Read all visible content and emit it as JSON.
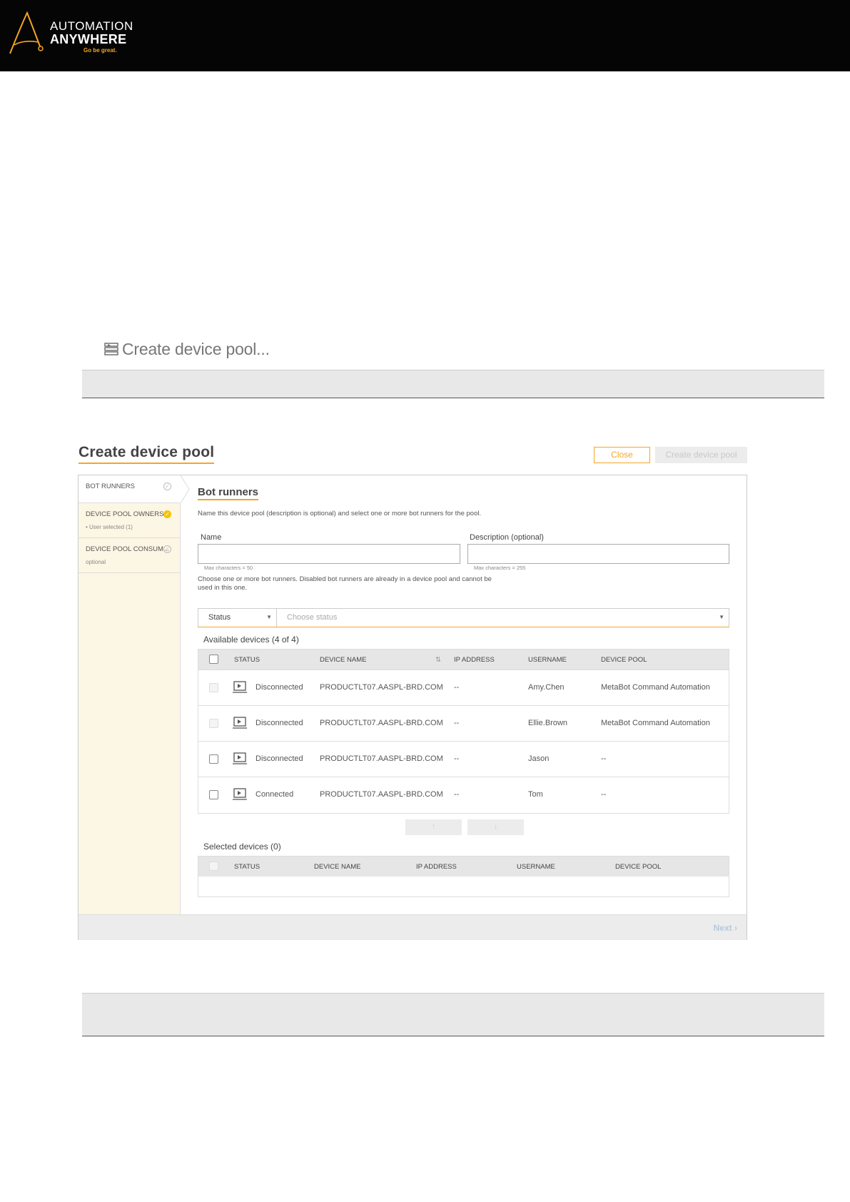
{
  "brand": {
    "line1": "AUTOMATION",
    "line2": "ANYWHERE",
    "tagline": "Go be great.",
    "accent": "#f5a623"
  },
  "section": {
    "icon": "device-pool-icon",
    "title": "Create device pool..."
  },
  "dialog": {
    "title": "Create device pool",
    "close_label": "Close",
    "create_label": "Create device pool",
    "next_label": "Next",
    "steps": [
      {
        "label": "BOT RUNNERS",
        "sub": ""
      },
      {
        "label": "DEVICE POOL OWNERS",
        "sub": "• User selected (1)"
      },
      {
        "label": "DEVICE POOL CONSUM...",
        "sub": "optional"
      }
    ],
    "panel": {
      "title": "Bot runners",
      "description": "Name this device pool (description is optional) and select one or more bot runners for the pool.",
      "name_label": "Name",
      "name_value": "",
      "name_hint": "Max characters = 50",
      "desc_label": "Description (optional)",
      "desc_value": "",
      "desc_hint": "Max characters = 255",
      "choose_text": "Choose one or more bot runners. Disabled bot runners are already in a device pool and cannot be used in this one.",
      "filter_field": "Status",
      "filter_placeholder": "Choose status",
      "available_label": "Available devices (4 of 4)",
      "columns": [
        "STATUS",
        "DEVICE NAME",
        "IP ADDRESS",
        "USERNAME",
        "DEVICE POOL"
      ],
      "rows": [
        {
          "status": "Disconnected",
          "device": "PRODUCTLT07.AASPL-BRD.COM",
          "ip": "--",
          "user": "Amy.Chen",
          "pool": "MetaBot Command Automation",
          "disabled": true
        },
        {
          "status": "Disconnected",
          "device": "PRODUCTLT07.AASPL-BRD.COM",
          "ip": "--",
          "user": "Ellie.Brown",
          "pool": "MetaBot Command Automation",
          "disabled": true
        },
        {
          "status": "Disconnected",
          "device": "PRODUCTLT07.AASPL-BRD.COM",
          "ip": "--",
          "user": "Jason",
          "pool": "--",
          "disabled": false
        },
        {
          "status": "Connected",
          "device": "PRODUCTLT07.AASPL-BRD.COM",
          "ip": "--",
          "user": "Tom",
          "pool": "--",
          "disabled": false
        }
      ],
      "move_down_label": "↑",
      "move_up_label": "↓",
      "selected_label": "Selected devices (0)"
    }
  }
}
